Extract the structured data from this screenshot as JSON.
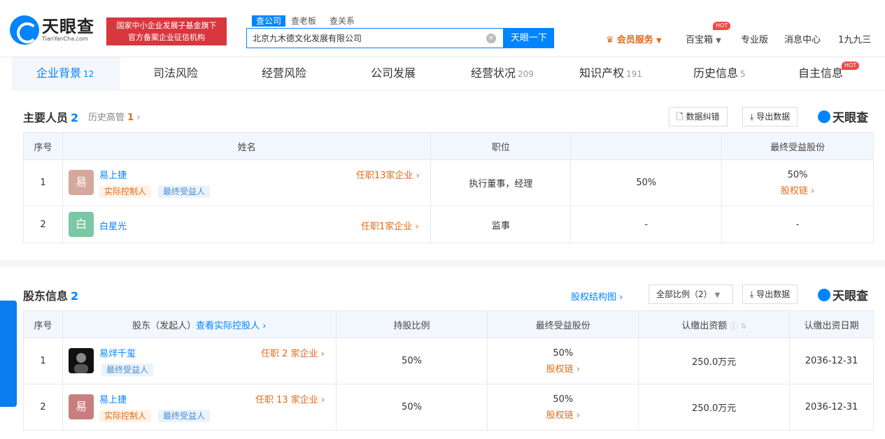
{
  "header": {
    "logo_cn": "天眼查",
    "logo_en": "TianYanCha.com",
    "badge_line1": "国家中小企业发展子基金旗下",
    "badge_line2": "官方备案企业征信机构",
    "search_tabs": [
      "查公司",
      "查老板",
      "查关系"
    ],
    "search_value": "北京九木德文化发展有限公司",
    "search_button": "天眼一下",
    "nav": {
      "vip": "会员服务",
      "baibaoxiang": "百宝箱",
      "pro": "专业版",
      "messages": "消息中心",
      "user": "1九九三"
    },
    "hot": "HOT"
  },
  "tabs": [
    {
      "label": "企业背景",
      "count": "12"
    },
    {
      "label": "司法风险",
      "count": ""
    },
    {
      "label": "经营风险",
      "count": ""
    },
    {
      "label": "公司发展",
      "count": ""
    },
    {
      "label": "经营状况",
      "count": "209"
    },
    {
      "label": "知识产权",
      "count": "191"
    },
    {
      "label": "历史信息",
      "count": "5"
    },
    {
      "label": "自主信息",
      "count": ""
    }
  ],
  "personnel": {
    "title": "主要人员",
    "count": "2",
    "history_label": "历史高管",
    "history_count": "1",
    "btn_correct": "数据纠错",
    "btn_export": "导出数据",
    "brand": "天眼查",
    "headers": [
      "序号",
      "姓名",
      "职位",
      "",
      "最终受益股份"
    ],
    "rows": [
      {
        "no": "1",
        "avatar": "易",
        "name": "易上捷",
        "jobs": "任职13家企业",
        "tag1": "实际控制人",
        "tag2": "最终受益人",
        "position": "执行董事，经理",
        "ratio": "50%",
        "final": "50%",
        "chain": "股权链"
      },
      {
        "no": "2",
        "avatar": "白",
        "name": "白星光",
        "jobs": "任职1家企业",
        "position": "监事",
        "ratio": "-",
        "final": "-"
      }
    ]
  },
  "shareholders": {
    "title": "股东信息",
    "count": "2",
    "structure_link": "股权结构图",
    "filter": "全部比例（2）",
    "btn_export": "导出数据",
    "brand": "天眼查",
    "headers": [
      "序号",
      "股东（发起人）",
      "查看实际控股人",
      "持股比例",
      "最终受益股份",
      "认缴出资额",
      "认缴出资日期"
    ],
    "rows": [
      {
        "no": "1",
        "name": "易烊千玺",
        "jobs": "任职 2 家企业",
        "tag2": "最终受益人",
        "ratio": "50%",
        "final": "50%",
        "chain": "股权链",
        "amount": "250.0万元",
        "date": "2036-12-31"
      },
      {
        "no": "2",
        "avatar": "易",
        "name": "易上捷",
        "jobs": "任职 13 家企业",
        "tag1": "实际控制人",
        "tag2": "最终受益人",
        "ratio": "50%",
        "final": "50%",
        "chain": "股权链",
        "amount": "250.0万元",
        "date": "2036-12-31"
      }
    ]
  },
  "colors": {
    "primary": "#0084ff",
    "accent": "#e06b1a",
    "badge": "#d9363e"
  }
}
